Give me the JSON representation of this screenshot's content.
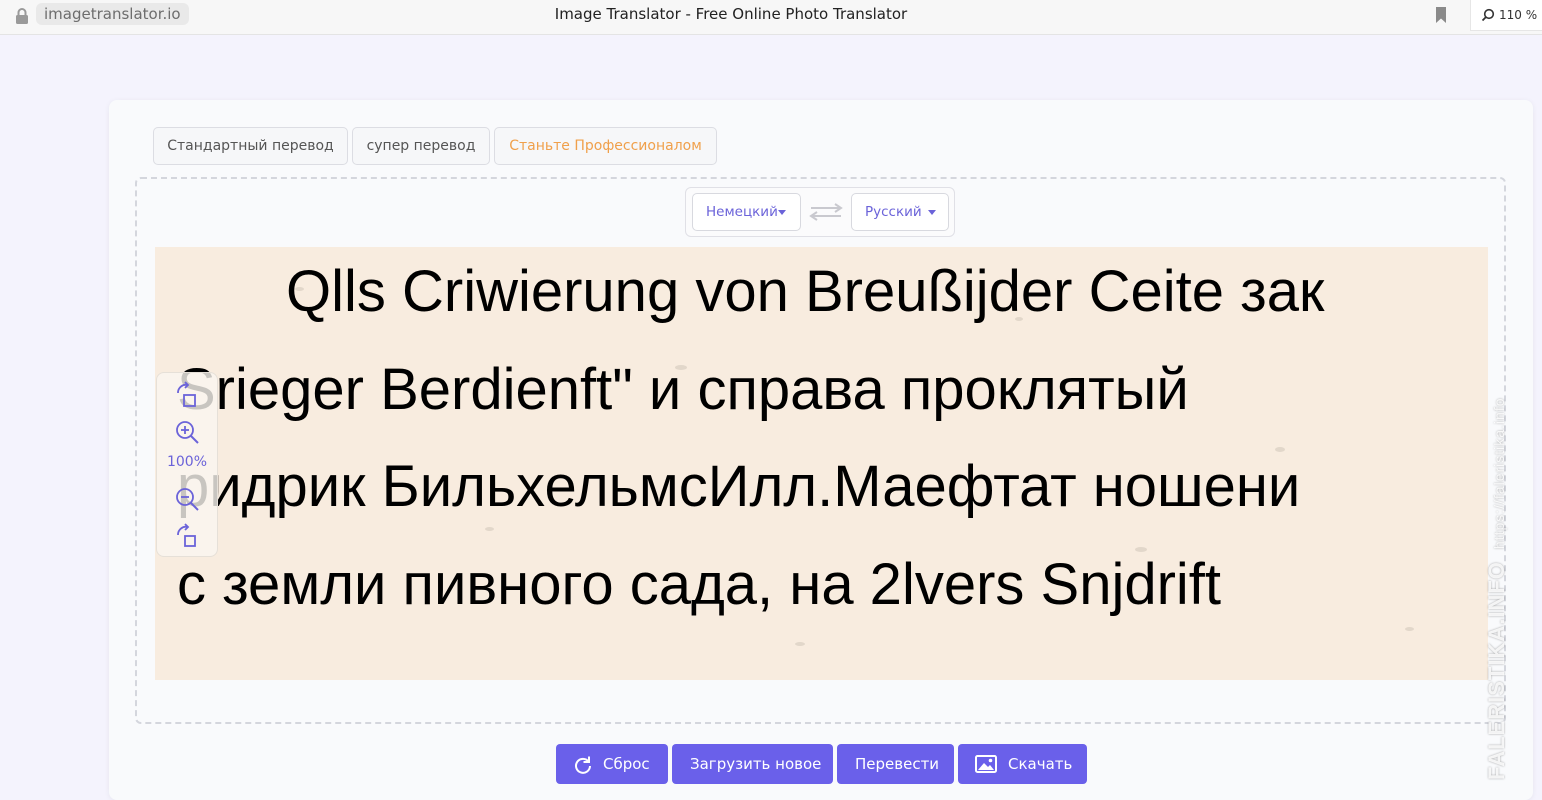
{
  "browser": {
    "url": "imagetranslator.io",
    "title": "Image Translator - Free Online Photo Translator",
    "zoom": "110 %"
  },
  "tabs": [
    "Стандартный перевод",
    "супер перевод",
    "Станьте Профессионалом"
  ],
  "languages": {
    "source": "Немецкий",
    "target": "Русский"
  },
  "image_text": [
    "Qlls Criwierung von Breußijder Ceite зак",
    "Srieger Berdienft\" и справа проклятый",
    "ридрик БильхельмсИлл.Маефтат ношени",
    "с земли пивного сада, на 2lvers Snjdrift"
  ],
  "zoom_panel": {
    "percent": "100%"
  },
  "buttons": {
    "reset": "Сброс",
    "upload": "Загрузить новое",
    "translate": "Перевести",
    "download": "Скачать"
  },
  "watermark": {
    "brand": "FALERISTIKA.INFO",
    "url": "https://faleristika.info"
  },
  "colors": {
    "accent": "#6a60ea",
    "pro_tab": "#f0a04b",
    "image_bg": "#f8ecdf"
  }
}
